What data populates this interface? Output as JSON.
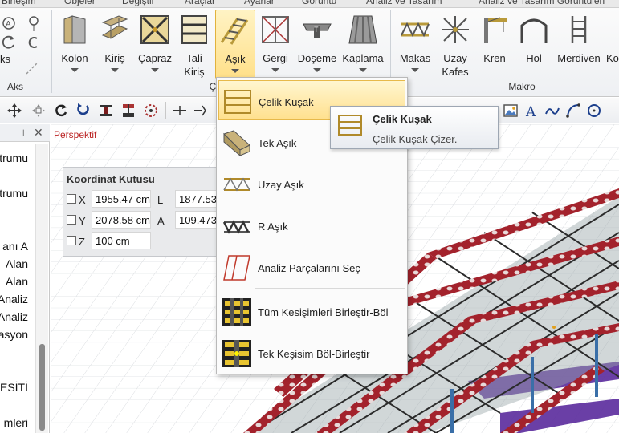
{
  "menu": {
    "items": [
      "Birleşim",
      "Objeler",
      "Değiştir",
      "Araçlar",
      "Ayarlar",
      "Görüntü",
      "Analiz ve Tasarım",
      "Analiz ve Tasarım Görüntüleri"
    ]
  },
  "ribbon": {
    "groups": {
      "aks": "Aks",
      "celik_partial": "Ç",
      "makro": "Makro"
    },
    "aks_partial_label": "ks",
    "buttons": {
      "kolon": "Kolon",
      "kiris": "Kiriş",
      "capraz": "Çapraz",
      "tali_kiris_1": "Tali",
      "tali_kiris_2": "Kiriş",
      "asik": "Aşık",
      "gergi": "Gergi",
      "doseme": "Döşeme",
      "kaplama": "Kaplama",
      "makas": "Makas",
      "uzay_kafes_1": "Uzay",
      "uzay_kafes_2": "Kafes",
      "kren": "Kren",
      "hol": "Hol",
      "merdiven": "Merdiven",
      "ko_partial": "Ko"
    }
  },
  "left_panel": {
    "items": [
      "trumu",
      "trumu",
      "anı A",
      "Alan",
      "Alan",
      "Analiz",
      "Analiz",
      "nasyon",
      "KESİTİ",
      "mleri"
    ]
  },
  "viewport": {
    "title": "Perspektif"
  },
  "coord_box": {
    "title": "Koordinat Kutusu",
    "x_label": "X",
    "y_label": "Y",
    "z_label": "Z",
    "x_value": "1955.47 cm",
    "y_value": "2078.58 cm",
    "z_value": "100 cm",
    "l_label": "L",
    "a_label": "A",
    "l_value": "1877.53",
    "a_value": "109.473"
  },
  "dropdown": {
    "items": [
      "Çelik Kuşak",
      "Tek Aşık",
      "Uzay Aşık",
      "R Aşık",
      "Analiz Parçalarını Seç",
      "Tüm Kesişimleri Birleştir-Böl",
      "Tek Keşisim Böl-Birleştir"
    ]
  },
  "tooltip": {
    "title": "Çelik Kuşak",
    "description": "Çelik Kuşak Çizer."
  },
  "colors": {
    "highlight": "#ffe08a",
    "steel_red": "#a3222c",
    "steel_dark": "#2b2b2b",
    "roof_purple": "#5a2a9c"
  }
}
